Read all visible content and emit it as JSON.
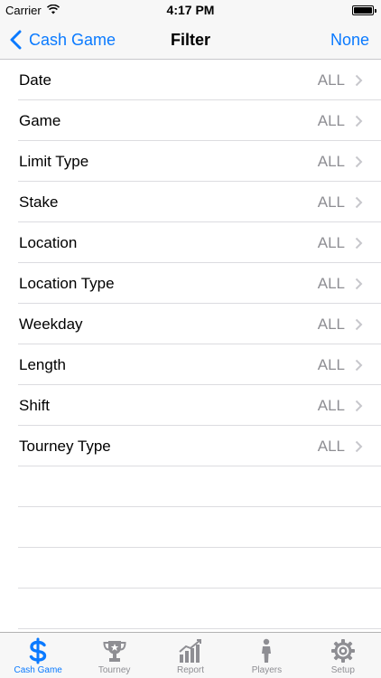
{
  "status_bar": {
    "carrier": "Carrier",
    "time": "4:17 PM"
  },
  "nav": {
    "back_label": "Cash Game",
    "title": "Filter",
    "right_label": "None"
  },
  "filters": [
    {
      "label": "Date",
      "value": "ALL"
    },
    {
      "label": "Game",
      "value": "ALL"
    },
    {
      "label": "Limit Type",
      "value": "ALL"
    },
    {
      "label": "Stake",
      "value": "ALL"
    },
    {
      "label": "Location",
      "value": "ALL"
    },
    {
      "label": "Location Type",
      "value": "ALL"
    },
    {
      "label": "Weekday",
      "value": "ALL"
    },
    {
      "label": "Length",
      "value": "ALL"
    },
    {
      "label": "Shift",
      "value": "ALL"
    },
    {
      "label": "Tourney Type",
      "value": "ALL"
    }
  ],
  "tabs": [
    {
      "label": "Cash Game",
      "icon": "dollar-icon",
      "active": true
    },
    {
      "label": "Tourney",
      "icon": "trophy-icon",
      "active": false
    },
    {
      "label": "Report",
      "icon": "bar-chart-icon",
      "active": false
    },
    {
      "label": "Players",
      "icon": "person-icon",
      "active": false
    },
    {
      "label": "Setup",
      "icon": "gear-icon",
      "active": false
    }
  ],
  "colors": {
    "accent": "#0a7aff",
    "inactive": "#8e8e93",
    "separator": "#dcdce0",
    "bar_background": "#f7f7f7"
  }
}
